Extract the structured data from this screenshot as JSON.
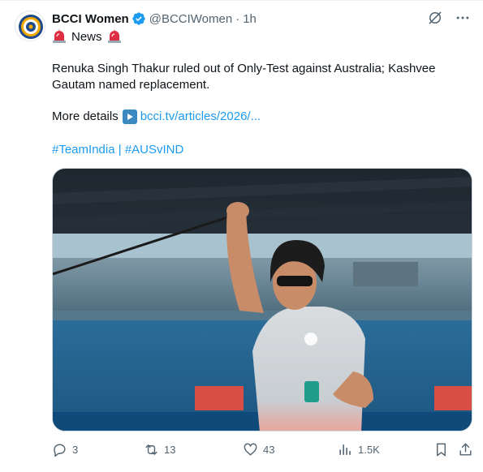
{
  "author": {
    "display_name": "BCCI Women",
    "handle": "@BCCIWomen",
    "separator": "·",
    "time": "1h",
    "verified": true
  },
  "category": {
    "label": "News",
    "icon": "police-siren-icon"
  },
  "body": {
    "text": "Renuka Singh Thakur ruled out of Only-Test against Australia; Kashvee Gautam named replacement.",
    "more_label": "More details",
    "link_icon": "play-button-icon",
    "link_text": "bcci.tv/articles/2026/..."
  },
  "hashtags": {
    "first": "#TeamIndia",
    "separator": "|",
    "second": "#AUSvIND"
  },
  "media": {
    "description_icon": "photo"
  },
  "actions": {
    "replies": "3",
    "reposts": "13",
    "likes": "43",
    "views": "1.5K"
  },
  "colors": {
    "accent": "#1d9bf0",
    "secondary_text": "#536471",
    "verified_badge": "#1d9bf0",
    "siren_red": "#dd2e44"
  }
}
